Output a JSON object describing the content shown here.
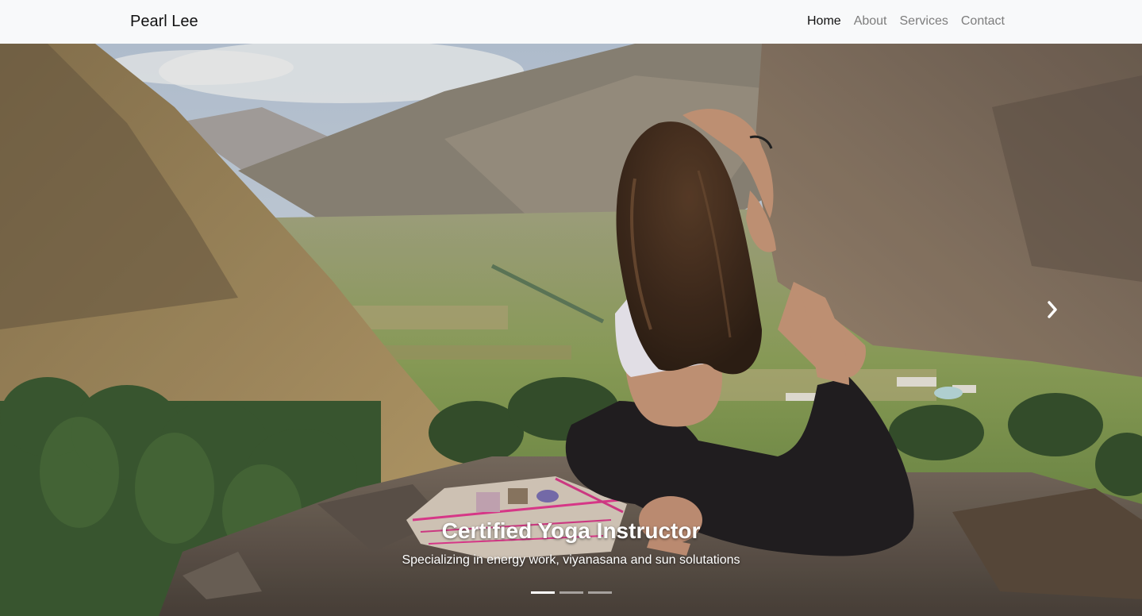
{
  "navbar": {
    "brand": "Pearl Lee",
    "links": [
      {
        "label": "Home",
        "active": true
      },
      {
        "label": "About",
        "active": false
      },
      {
        "label": "Services",
        "active": false
      },
      {
        "label": "Contact",
        "active": false
      }
    ]
  },
  "carousel": {
    "caption_title": "Certified Yoga Instructor",
    "caption_text": "Specializing in energy work, viyanasana and sun solutations",
    "next_icon": "chevron-right-icon",
    "slide_count": 3,
    "active_slide": 1
  },
  "colors": {
    "navbar_bg": "#f8f9fa",
    "brand_text": "#111111",
    "link_muted": "#7d7d7d",
    "caption_text": "#ffffff"
  }
}
